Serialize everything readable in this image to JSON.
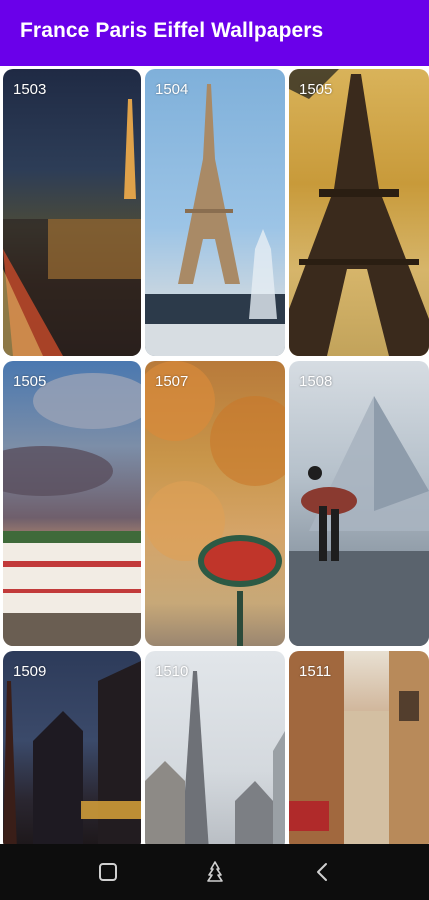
{
  "app": {
    "title": "France Paris Eiffel Wallpapers"
  },
  "wallpapers": [
    {
      "number": "1503"
    },
    {
      "number": "1504"
    },
    {
      "number": "1505"
    },
    {
      "number": "1505"
    },
    {
      "number": "1507"
    },
    {
      "number": "1508"
    },
    {
      "number": "1509"
    },
    {
      "number": "1510"
    },
    {
      "number": "1511"
    }
  ],
  "navbar": {
    "icons": [
      "recents-square-icon",
      "home-tree-icon",
      "back-chevron-icon"
    ]
  },
  "colors": {
    "appbar": "#6A00EA",
    "navbar": "#0D0D0D"
  }
}
